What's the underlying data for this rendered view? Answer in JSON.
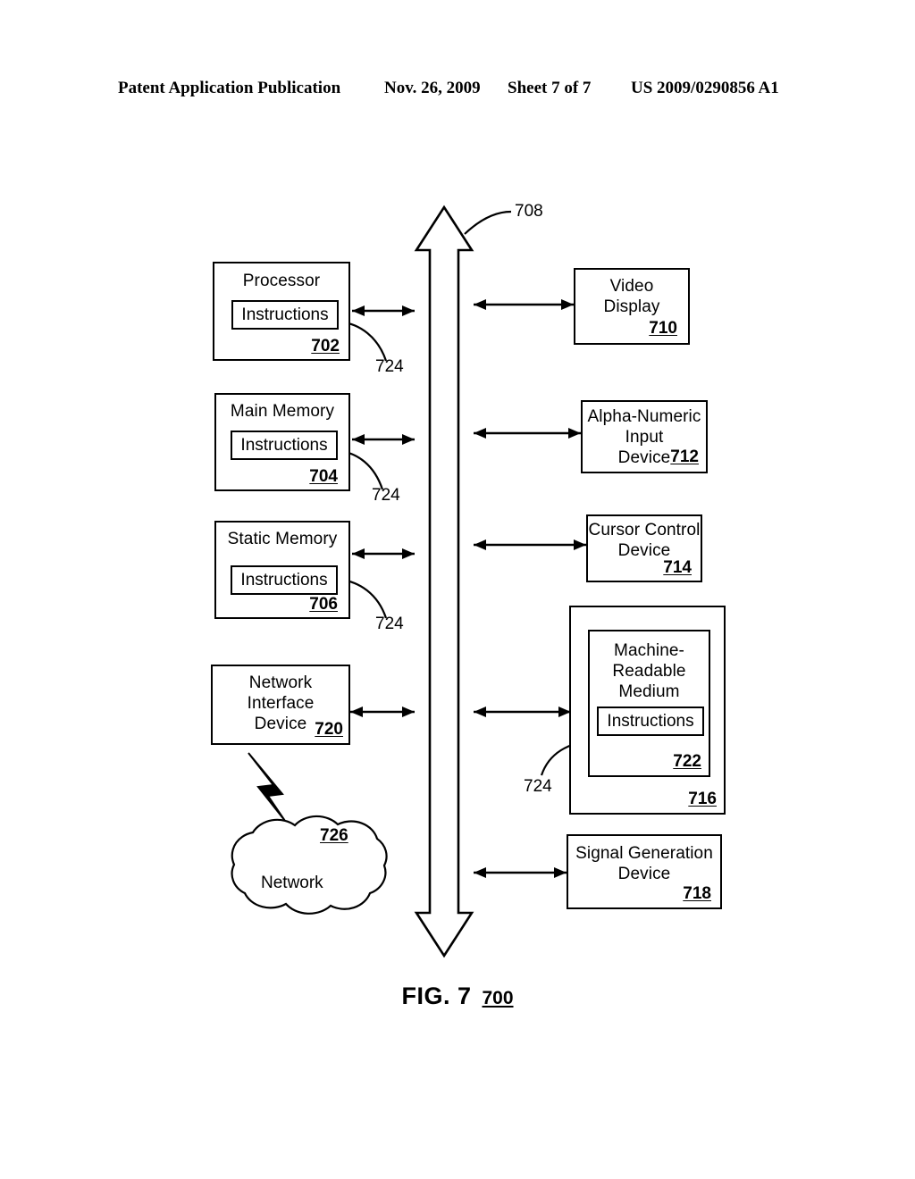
{
  "header": {
    "publication": "Patent Application Publication",
    "date": "Nov. 26, 2009",
    "sheet": "Sheet 7 of 7",
    "patent_number": "US 2009/0290856 A1"
  },
  "figure": {
    "caption_label": "FIG. 7",
    "caption_ref": "700",
    "bus_ref": "708",
    "bus_type": "bidirectional-hollow-arrow"
  },
  "blocks": {
    "processor": {
      "title": "Processor",
      "sub_box": "Instructions",
      "ref": "702",
      "leader_ref": "724"
    },
    "main_memory": {
      "title": "Main Memory",
      "sub_box": "Instructions",
      "ref": "704",
      "leader_ref": "724"
    },
    "static_memory": {
      "title": "Static Memory",
      "sub_box": "Instructions",
      "ref": "706",
      "leader_ref": "724"
    },
    "network_interface_device": {
      "line1": "Network",
      "line2": "Interface",
      "line3": "Device",
      "ref": "720"
    },
    "network_cloud": {
      "title": "Network",
      "ref": "726"
    },
    "video_display": {
      "line1": "Video",
      "line2": "Display",
      "ref": "710"
    },
    "alpha_numeric_input_device": {
      "line1": "Alpha-Numeric",
      "line2": "Input",
      "line3": "Device",
      "ref": "712"
    },
    "cursor_control_device": {
      "line1": "Cursor Control",
      "line2": "Device",
      "ref": "714"
    },
    "drive_unit": {
      "ref": "716"
    },
    "machine_readable_medium": {
      "line1": "Machine-",
      "line2": "Readable",
      "line3": "Medium",
      "sub_box": "Instructions",
      "ref": "722",
      "leader_ref": "724"
    },
    "signal_generation_device": {
      "line1": "Signal Generation",
      "line2": "Device",
      "ref": "718"
    }
  },
  "colors": {
    "ink": "#000000",
    "paper": "#ffffff"
  }
}
